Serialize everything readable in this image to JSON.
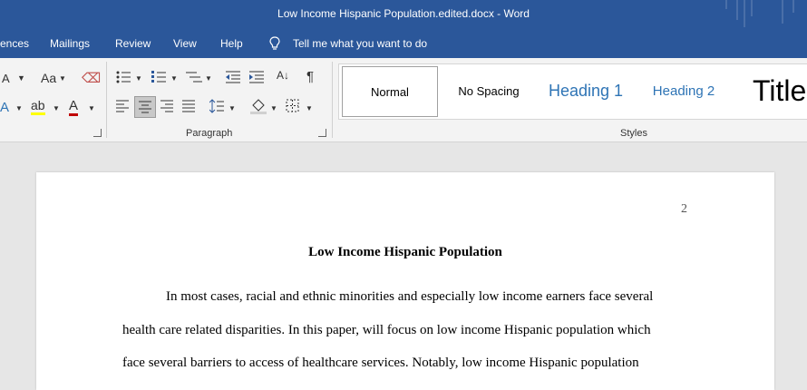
{
  "window": {
    "title": "Low Income Hispanic Population.edited.docx  -  Word"
  },
  "menu": {
    "items": [
      "ences",
      "Mailings",
      "Review",
      "View",
      "Help"
    ],
    "tell_me": "Tell me what you want to do"
  },
  "ribbon": {
    "font_case_label": "Aa",
    "font_size_small": "A",
    "paragraph_label": "Paragraph",
    "styles_label": "Styles",
    "styles": [
      "Normal",
      "No Spacing",
      "Heading 1",
      "Heading 2",
      "Title"
    ]
  },
  "colors": {
    "accent": "#2b579a",
    "heading": "#2e74b5"
  },
  "document": {
    "page_number": "2",
    "title": "Low Income Hispanic Population",
    "lines": [
      "In most cases, racial and ethnic minorities and especially low income earners face several",
      "health care related disparities. In this paper, will focus on low income Hispanic population which",
      "face several barriers to access of healthcare services. Notably, low income Hispanic population"
    ]
  }
}
